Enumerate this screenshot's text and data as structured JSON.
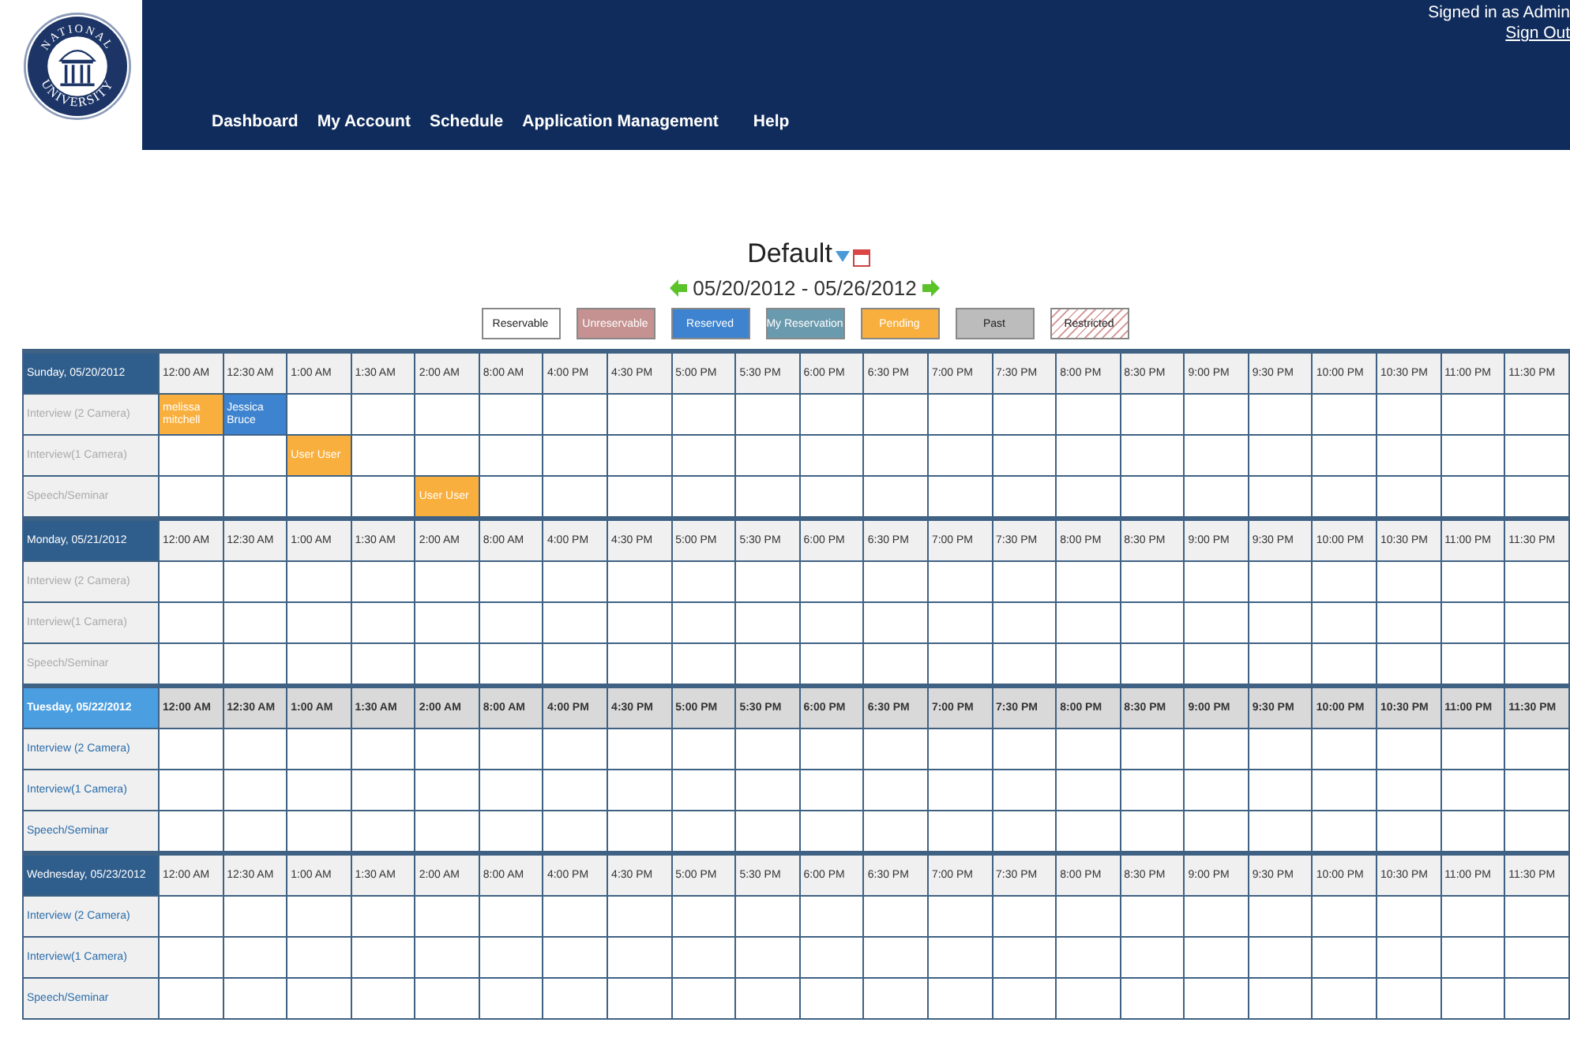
{
  "header": {
    "logo_text_top": "NATIONAL",
    "logo_text_bottom": "UNIVERSITY",
    "nav": [
      "Dashboard",
      "My Account",
      "Schedule",
      "Application Management",
      "Help"
    ],
    "signed_in": "Signed in as Admin",
    "sign_out": "Sign Out"
  },
  "schedule": {
    "title": "Default",
    "date_range": "05/20/2012 - 05/26/2012"
  },
  "legend": [
    {
      "label": "Reservable",
      "kind": "reservable"
    },
    {
      "label": "Unreservable",
      "kind": "unreservable"
    },
    {
      "label": "Reserved",
      "kind": "reserved"
    },
    {
      "label": "My Reservation",
      "kind": "mine"
    },
    {
      "label": "Pending",
      "kind": "pending"
    },
    {
      "label": "Past",
      "kind": "past"
    },
    {
      "label": "Restricted",
      "kind": "restricted"
    }
  ],
  "days": [
    {
      "label": "Sunday, 05/20/2012",
      "past": true,
      "today": false,
      "times": [
        "12:00 AM",
        "12:30 AM",
        "1:00 AM",
        "1:30 AM",
        "2:00 AM",
        "8:00 AM",
        "4:00 PM",
        "4:30 PM",
        "5:00 PM",
        "5:30 PM",
        "6:00 PM",
        "6:30 PM",
        "7:00 PM",
        "7:30 PM",
        "8:00 PM",
        "8:30 PM",
        "9:00 PM",
        "9:30 PM",
        "10:00 PM",
        "10:30 PM",
        "11:00 PM",
        "11:30 PM"
      ],
      "resources": [
        {
          "name": "Interview (2 Camera)",
          "cells": [
            {
              "kind": "pending",
              "name": "melissa mitchell"
            },
            {
              "kind": "reserved",
              "name": "Jessica Bruce"
            },
            {
              "kind": "reservable"
            },
            {
              "kind": "reservable"
            },
            {
              "kind": "reservable"
            },
            {
              "kind": "reservable"
            },
            {
              "kind": "reservable"
            },
            {
              "kind": "reservable"
            },
            {
              "kind": "reservable"
            },
            {
              "kind": "reservable"
            },
            {
              "kind": "reservable"
            },
            {
              "kind": "reservable"
            },
            {
              "kind": "reservable"
            },
            {
              "kind": "reservable"
            },
            {
              "kind": "reservable"
            },
            {
              "kind": "reservable"
            },
            {
              "kind": "reservable"
            },
            {
              "kind": "reservable"
            },
            {
              "kind": "reservable"
            },
            {
              "kind": "reservable"
            },
            {
              "kind": "reservable"
            },
            {
              "kind": "reservable"
            }
          ]
        },
        {
          "name": "Interview(1 Camera)",
          "cells": [
            {
              "kind": "reservable"
            },
            {
              "kind": "reservable"
            },
            {
              "kind": "pending",
              "name": "User User"
            },
            {
              "kind": "reservable"
            },
            {
              "kind": "reservable"
            },
            {
              "kind": "reservable"
            },
            {
              "kind": "reservable"
            },
            {
              "kind": "reservable"
            },
            {
              "kind": "reservable"
            },
            {
              "kind": "reservable"
            },
            {
              "kind": "reservable"
            },
            {
              "kind": "reservable"
            },
            {
              "kind": "reservable"
            },
            {
              "kind": "reservable"
            },
            {
              "kind": "reservable"
            },
            {
              "kind": "reservable"
            },
            {
              "kind": "reservable"
            },
            {
              "kind": "reservable"
            },
            {
              "kind": "reservable"
            },
            {
              "kind": "reservable"
            },
            {
              "kind": "reservable"
            },
            {
              "kind": "reservable"
            }
          ]
        },
        {
          "name": "Speech/Seminar",
          "cells": [
            {
              "kind": "reservable"
            },
            {
              "kind": "reservable"
            },
            {
              "kind": "reservable"
            },
            {
              "kind": "reservable"
            },
            {
              "kind": "pending",
              "name": "User User"
            },
            {
              "kind": "reservable"
            },
            {
              "kind": "reservable"
            },
            {
              "kind": "reservable"
            },
            {
              "kind": "reservable"
            },
            {
              "kind": "reservable"
            },
            {
              "kind": "reservable"
            },
            {
              "kind": "reservable"
            },
            {
              "kind": "reservable"
            },
            {
              "kind": "reservable"
            },
            {
              "kind": "reservable"
            },
            {
              "kind": "reservable"
            },
            {
              "kind": "reservable"
            },
            {
              "kind": "reservable"
            },
            {
              "kind": "reservable"
            },
            {
              "kind": "reservable"
            },
            {
              "kind": "reservable"
            },
            {
              "kind": "reservable"
            }
          ]
        }
      ]
    },
    {
      "label": "Monday, 05/21/2012",
      "past": true,
      "today": false,
      "times": [
        "12:00 AM",
        "12:30 AM",
        "1:00 AM",
        "1:30 AM",
        "2:00 AM",
        "8:00 AM",
        "4:00 PM",
        "4:30 PM",
        "5:00 PM",
        "5:30 PM",
        "6:00 PM",
        "6:30 PM",
        "7:00 PM",
        "7:30 PM",
        "8:00 PM",
        "8:30 PM",
        "9:00 PM",
        "9:30 PM",
        "10:00 PM",
        "10:30 PM",
        "11:00 PM",
        "11:30 PM"
      ],
      "resources": [
        {
          "name": "Interview (2 Camera)",
          "cells": [
            {
              "kind": "reservable"
            },
            {
              "kind": "reservable"
            },
            {
              "kind": "reservable"
            },
            {
              "kind": "reservable"
            },
            {
              "kind": "reservable"
            },
            {
              "kind": "reservable"
            },
            {
              "kind": "reservable"
            },
            {
              "kind": "reservable"
            },
            {
              "kind": "reservable"
            },
            {
              "kind": "reservable"
            },
            {
              "kind": "reservable"
            },
            {
              "kind": "reservable"
            },
            {
              "kind": "reservable"
            },
            {
              "kind": "reservable"
            },
            {
              "kind": "reservable"
            },
            {
              "kind": "reservable"
            },
            {
              "kind": "reservable"
            },
            {
              "kind": "reservable"
            },
            {
              "kind": "reservable"
            },
            {
              "kind": "reservable"
            },
            {
              "kind": "reservable"
            },
            {
              "kind": "reservable"
            }
          ]
        },
        {
          "name": "Interview(1 Camera)",
          "cells": [
            {
              "kind": "reservable"
            },
            {
              "kind": "reservable"
            },
            {
              "kind": "reservable"
            },
            {
              "kind": "reservable"
            },
            {
              "kind": "reservable"
            },
            {
              "kind": "reservable"
            },
            {
              "kind": "reservable"
            },
            {
              "kind": "reservable"
            },
            {
              "kind": "reservable"
            },
            {
              "kind": "reservable"
            },
            {
              "kind": "reservable"
            },
            {
              "kind": "reservable"
            },
            {
              "kind": "reservable"
            },
            {
              "kind": "reservable"
            },
            {
              "kind": "reservable"
            },
            {
              "kind": "reservable"
            },
            {
              "kind": "reservable"
            },
            {
              "kind": "reservable"
            },
            {
              "kind": "reservable"
            },
            {
              "kind": "reservable"
            },
            {
              "kind": "reservable"
            },
            {
              "kind": "reservable"
            }
          ]
        },
        {
          "name": "Speech/Seminar",
          "cells": [
            {
              "kind": "reservable"
            },
            {
              "kind": "reservable"
            },
            {
              "kind": "reservable"
            },
            {
              "kind": "reservable"
            },
            {
              "kind": "reservable"
            },
            {
              "kind": "reservable"
            },
            {
              "kind": "reservable"
            },
            {
              "kind": "reservable"
            },
            {
              "kind": "reservable"
            },
            {
              "kind": "reservable"
            },
            {
              "kind": "reservable"
            },
            {
              "kind": "reservable"
            },
            {
              "kind": "reservable"
            },
            {
              "kind": "reservable"
            },
            {
              "kind": "reservable"
            },
            {
              "kind": "reservable"
            },
            {
              "kind": "reservable"
            },
            {
              "kind": "reservable"
            },
            {
              "kind": "reservable"
            },
            {
              "kind": "reservable"
            },
            {
              "kind": "reservable"
            },
            {
              "kind": "reservable"
            }
          ]
        }
      ]
    },
    {
      "label": "Tuesday, 05/22/2012",
      "past": false,
      "today": true,
      "times": [
        "12:00 AM",
        "12:30 AM",
        "1:00 AM",
        "1:30 AM",
        "2:00 AM",
        "8:00 AM",
        "4:00 PM",
        "4:30 PM",
        "5:00 PM",
        "5:30 PM",
        "6:00 PM",
        "6:30 PM",
        "7:00 PM",
        "7:30 PM",
        "8:00 PM",
        "8:30 PM",
        "9:00 PM",
        "9:30 PM",
        "10:00 PM",
        "10:30 PM",
        "11:00 PM",
        "11:30 PM"
      ],
      "resources": [
        {
          "name": "Interview (2 Camera)",
          "cells": [
            {
              "kind": "reservable"
            },
            {
              "kind": "reservable"
            },
            {
              "kind": "reservable"
            },
            {
              "kind": "reservable"
            },
            {
              "kind": "reservable"
            },
            {
              "kind": "reservable"
            },
            {
              "kind": "reservable"
            },
            {
              "kind": "reservable"
            },
            {
              "kind": "reservable"
            },
            {
              "kind": "reservable"
            },
            {
              "kind": "reservable"
            },
            {
              "kind": "reservable"
            },
            {
              "kind": "reservable"
            },
            {
              "kind": "reservable"
            },
            {
              "kind": "reservable"
            },
            {
              "kind": "reservable"
            },
            {
              "kind": "reservable"
            },
            {
              "kind": "reservable"
            },
            {
              "kind": "reservable"
            },
            {
              "kind": "reservable"
            },
            {
              "kind": "reservable"
            },
            {
              "kind": "reservable"
            }
          ]
        },
        {
          "name": "Interview(1 Camera)",
          "cells": [
            {
              "kind": "reservable"
            },
            {
              "kind": "reservable"
            },
            {
              "kind": "reservable"
            },
            {
              "kind": "reservable"
            },
            {
              "kind": "reservable"
            },
            {
              "kind": "reservable"
            },
            {
              "kind": "reservable"
            },
            {
              "kind": "reservable"
            },
            {
              "kind": "reservable"
            },
            {
              "kind": "reservable"
            },
            {
              "kind": "reservable"
            },
            {
              "kind": "reservable"
            },
            {
              "kind": "reservable"
            },
            {
              "kind": "reservable"
            },
            {
              "kind": "reservable"
            },
            {
              "kind": "reservable"
            },
            {
              "kind": "reservable"
            },
            {
              "kind": "reservable"
            },
            {
              "kind": "reservable"
            },
            {
              "kind": "reservable"
            },
            {
              "kind": "reservable"
            },
            {
              "kind": "reservable"
            }
          ]
        },
        {
          "name": "Speech/Seminar",
          "cells": [
            {
              "kind": "reservable"
            },
            {
              "kind": "reservable"
            },
            {
              "kind": "reservable"
            },
            {
              "kind": "reservable"
            },
            {
              "kind": "reservable"
            },
            {
              "kind": "reservable"
            },
            {
              "kind": "reservable"
            },
            {
              "kind": "reservable"
            },
            {
              "kind": "reservable"
            },
            {
              "kind": "reservable"
            },
            {
              "kind": "reservable"
            },
            {
              "kind": "reservable"
            },
            {
              "kind": "reservable"
            },
            {
              "kind": "reservable"
            },
            {
              "kind": "reservable"
            },
            {
              "kind": "reservable"
            },
            {
              "kind": "reservable"
            },
            {
              "kind": "reservable"
            },
            {
              "kind": "reservable"
            },
            {
              "kind": "reservable"
            },
            {
              "kind": "reservable"
            },
            {
              "kind": "reservable"
            }
          ]
        }
      ]
    },
    {
      "label": "Wednesday, 05/23/2012",
      "past": false,
      "today": false,
      "times": [
        "12:00 AM",
        "12:30 AM",
        "1:00 AM",
        "1:30 AM",
        "2:00 AM",
        "8:00 AM",
        "4:00 PM",
        "4:30 PM",
        "5:00 PM",
        "5:30 PM",
        "6:00 PM",
        "6:30 PM",
        "7:00 PM",
        "7:30 PM",
        "8:00 PM",
        "8:30 PM",
        "9:00 PM",
        "9:30 PM",
        "10:00 PM",
        "10:30 PM",
        "11:00 PM",
        "11:30 PM"
      ],
      "resources": [
        {
          "name": "Interview (2 Camera)",
          "cells": [
            {
              "kind": "reservable"
            },
            {
              "kind": "reservable"
            },
            {
              "kind": "reservable"
            },
            {
              "kind": "reservable"
            },
            {
              "kind": "reservable"
            },
            {
              "kind": "reservable"
            },
            {
              "kind": "reservable"
            },
            {
              "kind": "reservable"
            },
            {
              "kind": "reservable"
            },
            {
              "kind": "reservable"
            },
            {
              "kind": "reservable"
            },
            {
              "kind": "reservable"
            },
            {
              "kind": "reservable"
            },
            {
              "kind": "reservable"
            },
            {
              "kind": "reservable"
            },
            {
              "kind": "reservable"
            },
            {
              "kind": "reservable"
            },
            {
              "kind": "reservable"
            },
            {
              "kind": "reservable"
            },
            {
              "kind": "reservable"
            },
            {
              "kind": "reservable"
            },
            {
              "kind": "reservable"
            }
          ]
        },
        {
          "name": "Interview(1 Camera)",
          "cells": [
            {
              "kind": "reservable"
            },
            {
              "kind": "reservable"
            },
            {
              "kind": "reservable"
            },
            {
              "kind": "reservable"
            },
            {
              "kind": "reservable"
            },
            {
              "kind": "reservable"
            },
            {
              "kind": "reservable"
            },
            {
              "kind": "reservable"
            },
            {
              "kind": "reservable"
            },
            {
              "kind": "reservable"
            },
            {
              "kind": "reservable"
            },
            {
              "kind": "reservable"
            },
            {
              "kind": "reservable"
            },
            {
              "kind": "reservable"
            },
            {
              "kind": "reservable"
            },
            {
              "kind": "reservable"
            },
            {
              "kind": "reservable"
            },
            {
              "kind": "reservable"
            },
            {
              "kind": "reservable"
            },
            {
              "kind": "reservable"
            },
            {
              "kind": "reservable"
            },
            {
              "kind": "reservable"
            }
          ]
        },
        {
          "name": "Speech/Seminar",
          "cells": [
            {
              "kind": "reservable"
            },
            {
              "kind": "reservable"
            },
            {
              "kind": "reservable"
            },
            {
              "kind": "reservable"
            },
            {
              "kind": "reservable"
            },
            {
              "kind": "reservable"
            },
            {
              "kind": "reservable"
            },
            {
              "kind": "reservable"
            },
            {
              "kind": "reservable"
            },
            {
              "kind": "reservable"
            },
            {
              "kind": "reservable"
            },
            {
              "kind": "reservable"
            },
            {
              "kind": "reservable"
            },
            {
              "kind": "reservable"
            },
            {
              "kind": "reservable"
            },
            {
              "kind": "reservable"
            },
            {
              "kind": "reservable"
            },
            {
              "kind": "reservable"
            },
            {
              "kind": "reservable"
            },
            {
              "kind": "reservable"
            },
            {
              "kind": "reservable"
            },
            {
              "kind": "reservable"
            }
          ]
        }
      ]
    }
  ]
}
